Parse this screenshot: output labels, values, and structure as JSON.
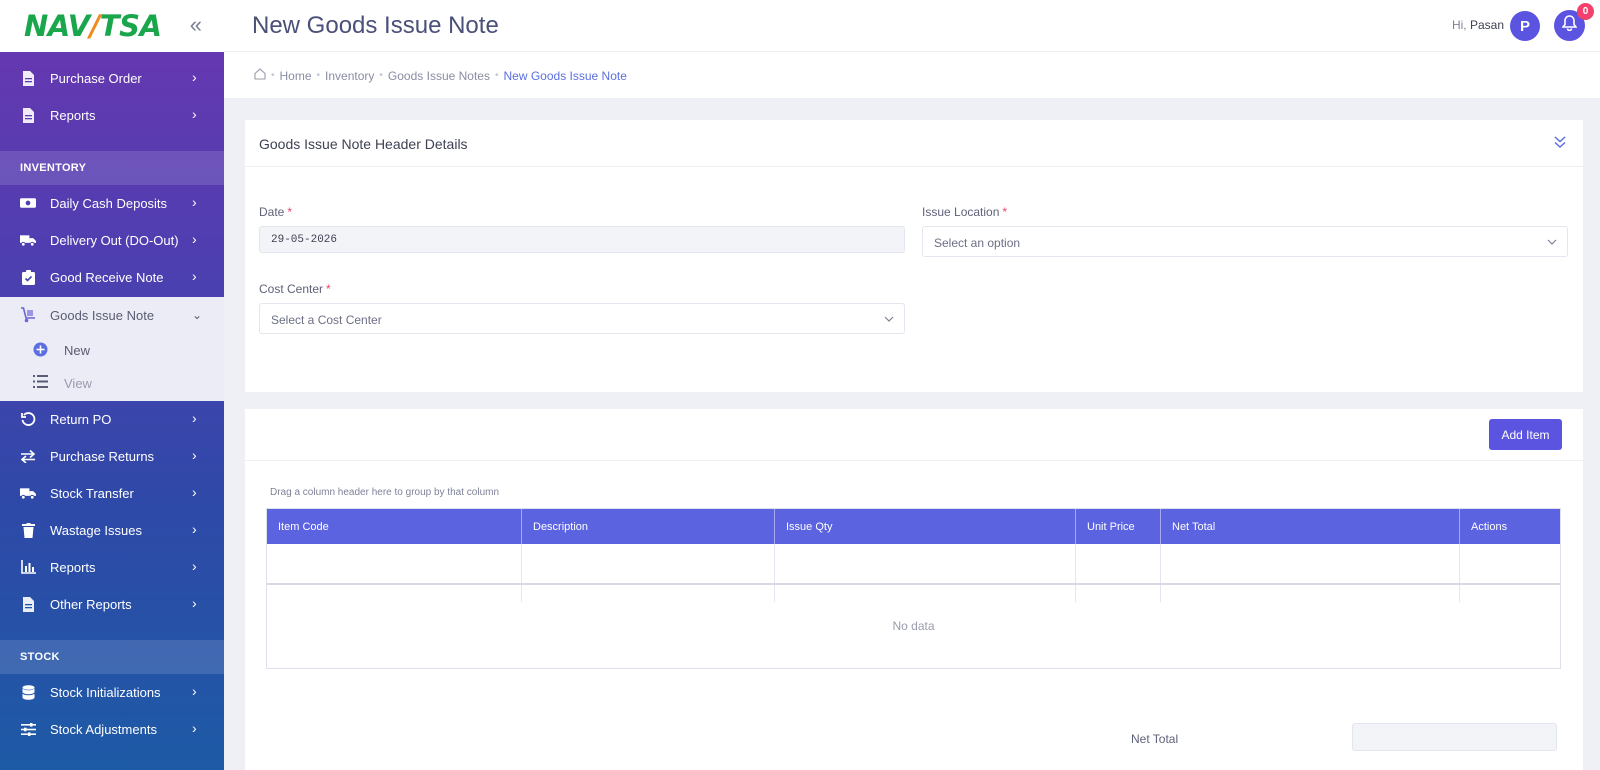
{
  "sidebar": {
    "logo_a": "NAV",
    "logo_slash": "/",
    "logo_b": "TSA",
    "logo_colors": {
      "green": "#1aa64a",
      "orange": "#f08a1c"
    },
    "collapse_icon": "double-chevron-left-icon",
    "top_items": [
      {
        "label": "Purchase Order",
        "icon": "document-icon"
      },
      {
        "label": "Reports",
        "icon": "document-icon"
      }
    ],
    "section_inventory": "INVENTORY",
    "inventory_items": [
      {
        "label": "Daily Cash Deposits",
        "icon": "cash-icon"
      },
      {
        "label": "Delivery Out (DO-Out)",
        "icon": "truck-icon"
      },
      {
        "label": "Good Receive Note",
        "icon": "clipboard-check-icon"
      },
      {
        "label": "Goods Issue Note",
        "icon": "dolly-icon",
        "expanded": true
      }
    ],
    "sub_items": [
      {
        "label": "New",
        "icon": "plus-circle-icon"
      },
      {
        "label": "View",
        "icon": "list-icon"
      }
    ],
    "more_items": [
      {
        "label": "Return PO",
        "icon": "undo-icon"
      },
      {
        "label": "Purchase Returns",
        "icon": "swap-icon"
      },
      {
        "label": "Stock Transfer",
        "icon": "truck-icon"
      },
      {
        "label": "Wastage Issues",
        "icon": "trash-icon"
      },
      {
        "label": "Reports",
        "icon": "bar-chart-icon"
      },
      {
        "label": "Other Reports",
        "icon": "document-icon"
      }
    ],
    "section_stock": "STOCK",
    "stock_items": [
      {
        "label": "Stock Initializations",
        "icon": "database-icon"
      },
      {
        "label": "Stock Adjustments",
        "icon": "sliders-icon"
      }
    ]
  },
  "header": {
    "title": "New Goods Issue Note",
    "greeting": "Hi,",
    "user": "Pasan",
    "avatar_letter": "P",
    "notifications": "0",
    "accent": "#5b54e0"
  },
  "breadcrumb": [
    "Home",
    "Inventory",
    "Goods Issue Notes",
    "New Goods Issue Note"
  ],
  "header_card": {
    "title": "Goods Issue Note Header Details",
    "date_label": "Date",
    "date_value": "29-05-2026",
    "issue_location_label": "Issue Location",
    "issue_location_placeholder": "Select an option",
    "cost_center_label": "Cost Center",
    "cost_center_placeholder": "Select a Cost Center",
    "required_mark": "*"
  },
  "items_card": {
    "add_button": "Add Item",
    "group_hint": "Drag a column header here to group by that column",
    "columns": [
      "Item Code",
      "Description",
      "Issue Qty",
      "Unit Price",
      "Net Total",
      "Actions"
    ],
    "empty_text": "No data",
    "net_total_label": "Net Total",
    "net_total_value": ""
  }
}
